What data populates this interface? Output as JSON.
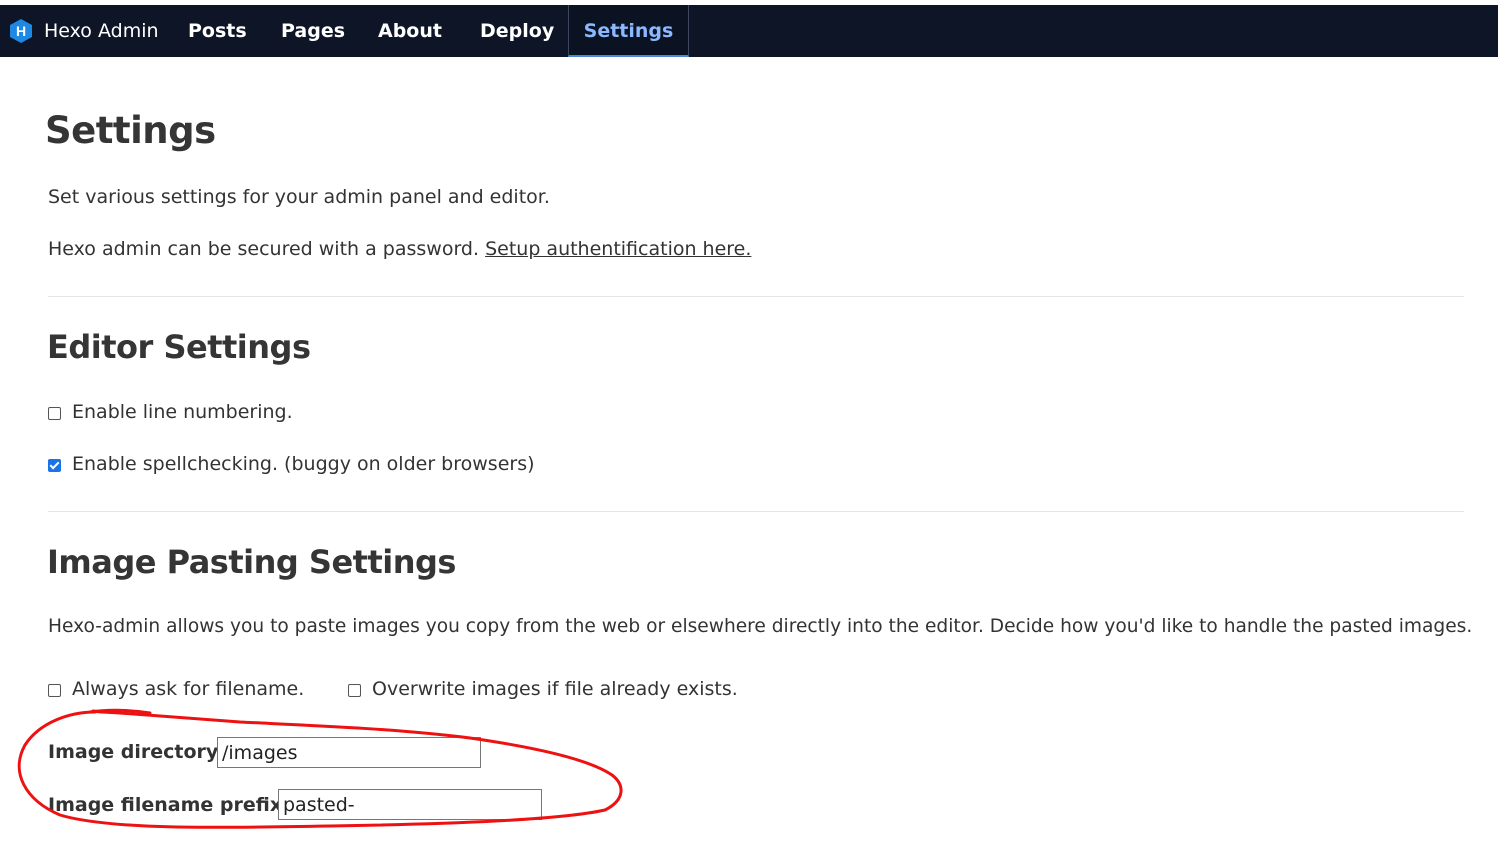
{
  "navbar": {
    "brand_text": "Hexo Admin",
    "brand_icon": "hexo-logo-icon",
    "items": [
      {
        "label": "Posts"
      },
      {
        "label": "Pages"
      },
      {
        "label": "About"
      },
      {
        "label": "Deploy"
      },
      {
        "label": "Settings",
        "active": true
      }
    ]
  },
  "page": {
    "title": "Settings",
    "intro": "Set various settings for your admin panel and editor.",
    "auth_text": "Hexo admin can be secured with a password. ",
    "auth_link": "Setup authentification here."
  },
  "editor_settings": {
    "title": "Editor Settings",
    "line_numbering": {
      "label": "Enable line numbering.",
      "checked": false
    },
    "spellcheck": {
      "label": "Enable spellchecking. (buggy on older browsers)",
      "checked": true
    }
  },
  "image_settings": {
    "title": "Image Pasting Settings",
    "description": "Hexo-admin allows you to paste images you copy from the web or elsewhere directly into the editor. Decide how you'd like to handle the pasted images.",
    "ask_filename": {
      "label": "Always ask for filename.",
      "checked": false
    },
    "overwrite": {
      "label": "Overwrite images if file already exists.",
      "checked": false
    },
    "directory_label": "Image directory:",
    "directory_value": "/images",
    "prefix_label": "Image filename prefix:",
    "prefix_value": "pasted-"
  },
  "colors": {
    "navbar_bg": "#0d1526",
    "active_nav": "#8bb8ff",
    "annotation": "#ee1111",
    "checkbox_checked": "#1a73e8"
  }
}
